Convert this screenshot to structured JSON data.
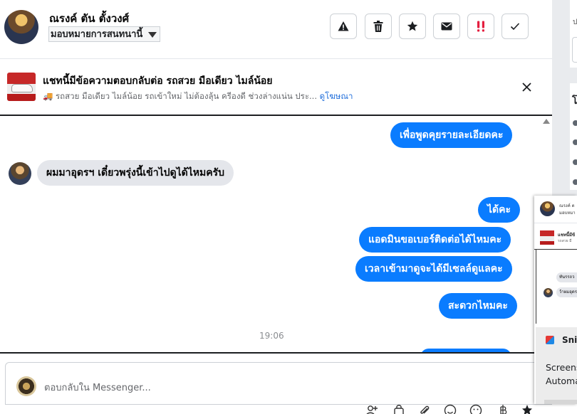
{
  "header": {
    "contact_name": "ณรงค์ ตัน ตั้งวงศ์",
    "assign_label": "มอบหมายการสนทนานี้",
    "actions": [
      {
        "icon": "warning-icon",
        "label": "Report"
      },
      {
        "icon": "trash-icon",
        "label": "Delete"
      },
      {
        "icon": "star-icon",
        "label": "Star"
      },
      {
        "icon": "envelope-icon",
        "label": "Mark unread"
      },
      {
        "icon": "double-exclamation-icon",
        "label": "Follow up"
      },
      {
        "icon": "checkmark-icon",
        "label": "Mark done"
      }
    ]
  },
  "ad_banner": {
    "title": "แชทนี้มีข้อความตอบกลับต่อ รถสวย มือเดียว ไมล์น้อย",
    "description": "รถสวย มือเดียว ไมล์น้อย รถเข้าใหม่ ไม่ต้องลุ้น ครีองดี ช่วงล่างแน่น ประ...",
    "link": "ดูโฆษณา"
  },
  "messages": [
    {
      "direction": "out",
      "text": "เพื่อพูดคุยรายละเอียดคะ"
    },
    {
      "direction": "in",
      "text": "ผมมาอุดรฯ เดี๋ยวพรุ่งนี้เข้าไปดูได้ไหมครับ"
    },
    {
      "direction": "out",
      "text": "ได้คะ"
    },
    {
      "direction": "out",
      "text": "แอดมินขอเบอร์ติดต่อได้ไหมคะ"
    },
    {
      "direction": "out",
      "text": "เวลาเข้ามาดูจะได้มีเซลล์ดูแลคะ"
    },
    {
      "direction": "out",
      "text": "สะดวกไหมคะ"
    }
  ],
  "timestamp": "19:06",
  "composer": {
    "placeholder": "ตอบกลับใน Messenger...",
    "tools": [
      "person-add-icon",
      "bag-icon",
      "paperclip-icon",
      "emoji-icon",
      "smiley-icon",
      "baht-icon",
      "pin-icon"
    ]
  },
  "preview_popup": {
    "name_line": "ณรงค์ ต",
    "assign_line": "มอบหมา",
    "ad_title": "แชทนี้มีข้",
    "ad_desc": "รถสวย มื",
    "msg1": "ทันรรถว",
    "msg2": "ว้าผมอุดร"
  },
  "snip_app": {
    "label": "Snip"
  },
  "toast": {
    "line1": "Screens",
    "line2": "Automa"
  },
  "colors": {
    "accent": "#0a7cff",
    "link": "#216fdb",
    "incoming_bubble": "#e4e6eb",
    "follow_up": "#e41e3f"
  }
}
